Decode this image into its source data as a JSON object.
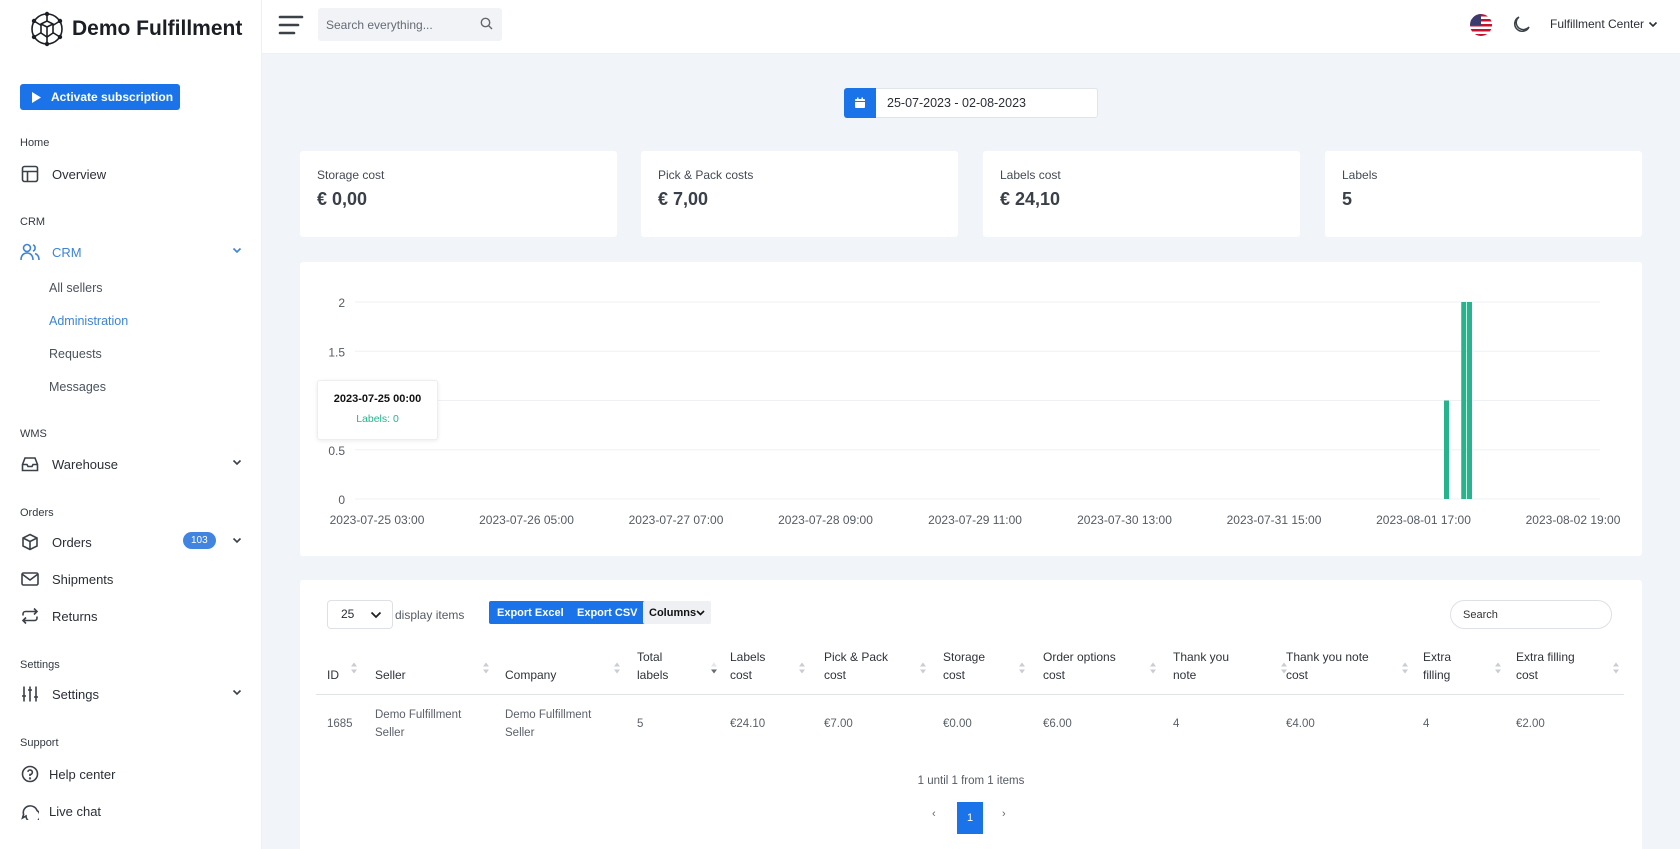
{
  "brand": {
    "name": "Demo Fulfillment"
  },
  "sidebar": {
    "activate_label": "Activate subscription",
    "sections": {
      "home": "Home",
      "crm": "CRM",
      "wms": "WMS",
      "orders": "Orders",
      "settings": "Settings",
      "support": "Support"
    },
    "items": {
      "overview": "Overview",
      "crm": "CRM",
      "all_sellers": "All sellers",
      "administration": "Administration",
      "requests": "Requests",
      "messages": "Messages",
      "warehouse": "Warehouse",
      "orders": "Orders",
      "orders_badge": "103",
      "shipments": "Shipments",
      "returns": "Returns",
      "settings": "Settings",
      "help_center": "Help center",
      "live_chat": "Live chat"
    }
  },
  "topbar": {
    "search_placeholder": "Search everything...",
    "account_label": "Fulfillment Center"
  },
  "date_range": "25-07-2023 - 02-08-2023",
  "cards": [
    {
      "label": "Storage cost",
      "value": "€ 0,00"
    },
    {
      "label": "Pick & Pack costs",
      "value": "€ 7,00"
    },
    {
      "label": "Labels cost",
      "value": "€ 24,10"
    },
    {
      "label": "Labels",
      "value": "5"
    }
  ],
  "chart_data": {
    "type": "bar",
    "y_ticks": [
      "0",
      "0.5",
      "1",
      "1.5",
      "2"
    ],
    "ylim": [
      0,
      2
    ],
    "x_ticks": [
      "2023-07-25 03:00",
      "2023-07-26 05:00",
      "2023-07-27 07:00",
      "2023-07-28 09:00",
      "2023-07-29 11:00",
      "2023-07-30 13:00",
      "2023-07-31 15:00",
      "2023-08-01 17:00",
      "2023-08-02 19:00"
    ],
    "x_range_hours": [
      0,
      208
    ],
    "bars": [
      {
        "hour": 186,
        "value": 1
      },
      {
        "hour": 189,
        "value": 2
      },
      {
        "hour": 190,
        "value": 2
      }
    ],
    "color": "#26b48e",
    "grid": true,
    "tooltip": {
      "title": "2023-07-25 00:00",
      "body": "Labels: 0"
    }
  },
  "table": {
    "per_page": "25",
    "display_label": "display items",
    "export_excel": "Export Excel",
    "export_csv": "Export CSV",
    "columns_label": "Columns",
    "search_placeholder": "Search",
    "headers": {
      "id": "ID",
      "seller": "Seller",
      "company": "Company",
      "total_labels": [
        "Total",
        "labels"
      ],
      "labels_cost": [
        "Labels",
        "cost"
      ],
      "pickpack_cost": [
        "Pick & Pack",
        "cost"
      ],
      "storage_cost": [
        "Storage",
        "cost"
      ],
      "order_options_cost": [
        "Order options",
        "cost"
      ],
      "thank_you_note": [
        "Thank you",
        "note"
      ],
      "thank_you_note_cost": [
        "Thank you note",
        "cost"
      ],
      "extra_filling": [
        "Extra",
        "filling"
      ],
      "extra_filling_cost": [
        "Extra filling",
        "cost"
      ]
    },
    "rows": [
      {
        "id": "1685",
        "seller": [
          "Demo Fulfillment",
          "Seller"
        ],
        "company": [
          "Demo Fulfillment",
          "Seller"
        ],
        "total_labels": "5",
        "labels_cost": "€24.10",
        "pickpack_cost": "€7.00",
        "storage_cost": "€0.00",
        "order_options_cost": "€6.00",
        "thank_you_note": "4",
        "thank_you_note_cost": "€4.00",
        "extra_filling": "4",
        "extra_filling_cost": "€2.00"
      }
    ],
    "pager_info": "1 until 1 from 1 items",
    "prev": "‹",
    "current_page": "1",
    "next": "›"
  }
}
